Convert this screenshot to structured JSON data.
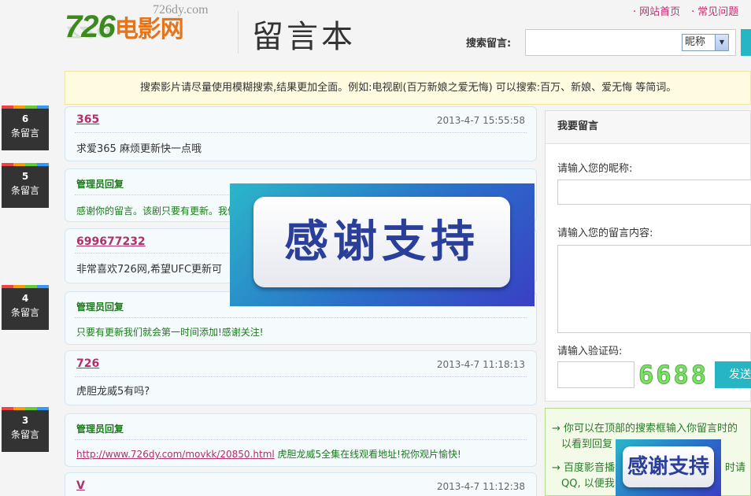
{
  "header": {
    "logo_main": "726",
    "logo_cn": "电影网",
    "logo_url": "726dy.com",
    "site_title": "留言本",
    "links": [
      "网站首页",
      "常见问题"
    ],
    "search_label": "搜索留言:",
    "search_value": "",
    "search_select": "昵称"
  },
  "notice": "搜索影片请尽量使用模糊搜索,结果更加全面。例如:电视剧(百万新娘之爱无悔) 可以搜索:百万、新娘、爱无悔 等简词。",
  "badge_unit": "条留言",
  "badges": [
    "6",
    "5",
    "4",
    "3"
  ],
  "messages": [
    {
      "user": "365",
      "time": "2013-4-7 15:55:58",
      "body": "求爱365 麻烦更新快一点哦"
    },
    {
      "admin_label": "管理员回复",
      "admin_body": "感谢你的留言。该剧只要有更新。我们"
    },
    {
      "user": "699677232",
      "time": "",
      "body": "非常喜欢726网,希望UFC更新可"
    },
    {
      "admin_label": "管理员回复",
      "admin_body": "只要有更新我们就会第一时间添加!感谢关注!"
    },
    {
      "user": "726",
      "time": "2013-4-7 11:18:13",
      "body": "虎胆龙威5有吗?"
    },
    {
      "admin_label": "管理员回复",
      "admin_link": "http://www.726dy.com/movkk/20850.html",
      "admin_body": " 虎胆龙威5全集在线观看地址!祝你观片愉快!"
    },
    {
      "user": "V",
      "time": "2013-4-7 11:12:38",
      "body": ""
    }
  ],
  "panel": {
    "title": "我要留言",
    "nick_label": "请输入您的昵称:",
    "content_label": "请输入您的留言内容:",
    "captcha_label": "请输入验证码:",
    "captcha_code": "6688",
    "submit_label": "发送"
  },
  "tips": [
    "你可以在顶部的搜索框输入你留言时的",
    "以看到回复",
    "百度影音播",
    "时请",
    "QQ, 以便我"
  ],
  "banners": {
    "large_text": "感谢支持",
    "small_text": "感谢支持"
  }
}
